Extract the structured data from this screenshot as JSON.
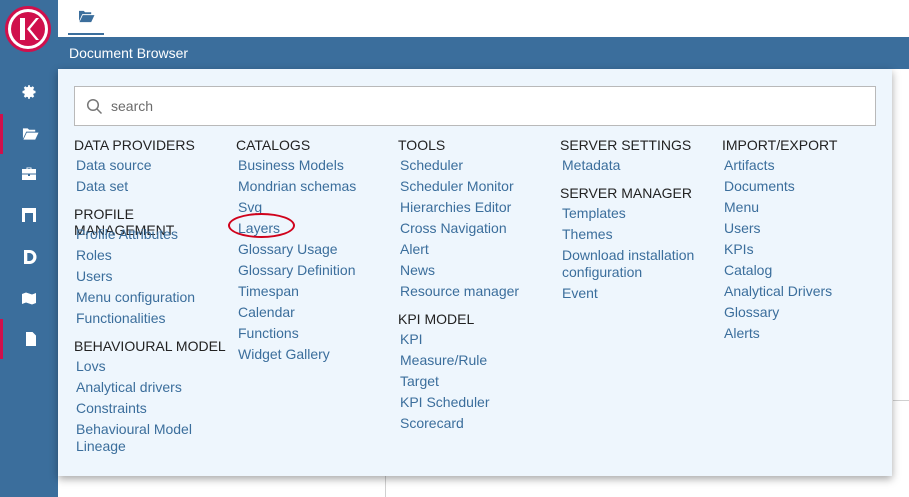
{
  "topbar": {
    "tab_icon": "folder-open-icon"
  },
  "titlebar": {
    "title": "Document Browser"
  },
  "sidebar": {
    "logo_letter": "K",
    "items": [
      {
        "icon": "gear-icon"
      },
      {
        "icon": "folder-open-icon",
        "active": true
      },
      {
        "icon": "briefcase-icon"
      },
      {
        "icon": "warehouse-icon"
      },
      {
        "icon": "d-letter-icon"
      },
      {
        "icon": "map-icon"
      },
      {
        "icon": "document-icon",
        "active": true
      }
    ]
  },
  "search": {
    "placeholder": "search",
    "value": ""
  },
  "menu": {
    "col1": [
      {
        "title": "DATA PROVIDERS",
        "items": [
          "Data source",
          "Data set"
        ]
      },
      {
        "title": "PROFILE MANAGEMENT",
        "items": [
          "Profile Attributes",
          "Roles",
          "Users",
          "Menu configuration",
          "Functionalities"
        ]
      },
      {
        "title": "BEHAVIOURAL MODEL",
        "items": [
          "Lovs",
          "Analytical drivers",
          "Constraints",
          "Behavioural Model Lineage"
        ]
      }
    ],
    "col2": [
      {
        "title": "CATALOGS",
        "items": [
          "Business Models",
          "Mondrian schemas",
          "Svg",
          "Layers",
          "Glossary Usage",
          "Glossary Definition",
          "Timespan",
          "Calendar",
          "Functions",
          "Widget Gallery"
        ]
      }
    ],
    "col3": [
      {
        "title": "TOOLS",
        "items": [
          "Scheduler",
          "Scheduler Monitor",
          "Hierarchies Editor",
          "Cross Navigation",
          "Alert",
          "News",
          "Resource manager"
        ]
      },
      {
        "title": "KPI MODEL",
        "items": [
          "KPI",
          "Measure/Rule",
          "Target",
          "KPI Scheduler",
          "Scorecard"
        ]
      }
    ],
    "col4": [
      {
        "title": "SERVER SETTINGS",
        "items": [
          "Metadata"
        ]
      },
      {
        "title": "SERVER MANAGER",
        "items": [
          "Templates",
          "Themes",
          "Download installation configuration",
          "Event"
        ]
      }
    ],
    "col5": [
      {
        "title": "IMPORT/EXPORT",
        "items": [
          "Artifacts",
          "Documents",
          "Menu",
          "Users",
          "KPIs",
          "Catalog",
          "Analytical Drivers",
          "Glossary",
          "Alerts"
        ]
      }
    ]
  },
  "colors": {
    "accent": "#3b6e9c",
    "brand": "#d0104c",
    "panel_bg": "#eef6fd",
    "highlight": "#d0021b"
  }
}
